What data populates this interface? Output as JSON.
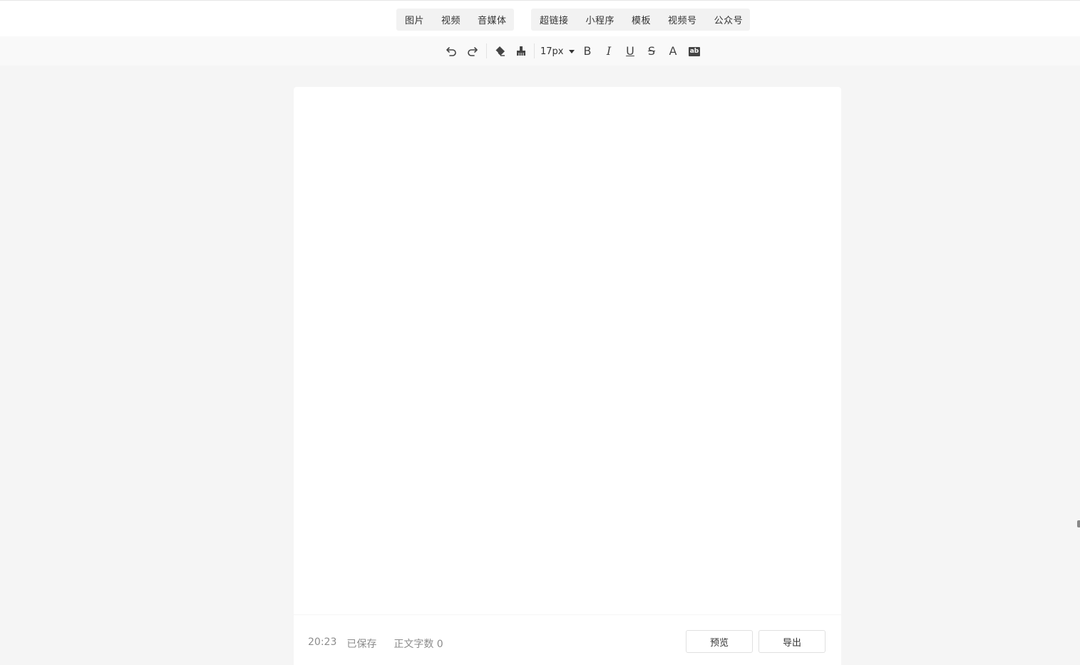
{
  "insert_menu": {
    "group1": [
      {
        "id": "image",
        "label": "图片"
      },
      {
        "id": "video",
        "label": "视频"
      },
      {
        "id": "audio",
        "label": "音媒体"
      }
    ],
    "group2": [
      {
        "id": "hyperlink",
        "label": "超链接"
      },
      {
        "id": "miniprogram",
        "label": "小程序"
      },
      {
        "id": "template",
        "label": "模板"
      },
      {
        "id": "channels",
        "label": "视频号"
      },
      {
        "id": "official_account",
        "label": "公众号"
      }
    ]
  },
  "toolbar": {
    "font_size": "17px",
    "buttons": [
      {
        "id": "undo",
        "icon": "undo-icon"
      },
      {
        "id": "redo",
        "icon": "redo-icon"
      },
      {
        "id": "eraser",
        "icon": "eraser-icon"
      },
      {
        "id": "format_painter",
        "icon": "format-painter-icon"
      },
      {
        "id": "bold",
        "label": "B"
      },
      {
        "id": "italic",
        "label": "I"
      },
      {
        "id": "underline",
        "label": "U"
      },
      {
        "id": "strikethrough",
        "label": "S"
      },
      {
        "id": "font_color",
        "label": "A"
      },
      {
        "id": "background_color",
        "label": "ab"
      }
    ]
  },
  "footer": {
    "time": "20:23",
    "save_status": "已保存",
    "word_count": "正文字数 0",
    "preview_label": "预览",
    "export_label": "导出"
  },
  "colors": {
    "page_bg": "#f5f5f5",
    "toolbar_bg": "#f9f9f9",
    "card_bg": "#ffffff",
    "muted_text": "#8c8c8c"
  }
}
